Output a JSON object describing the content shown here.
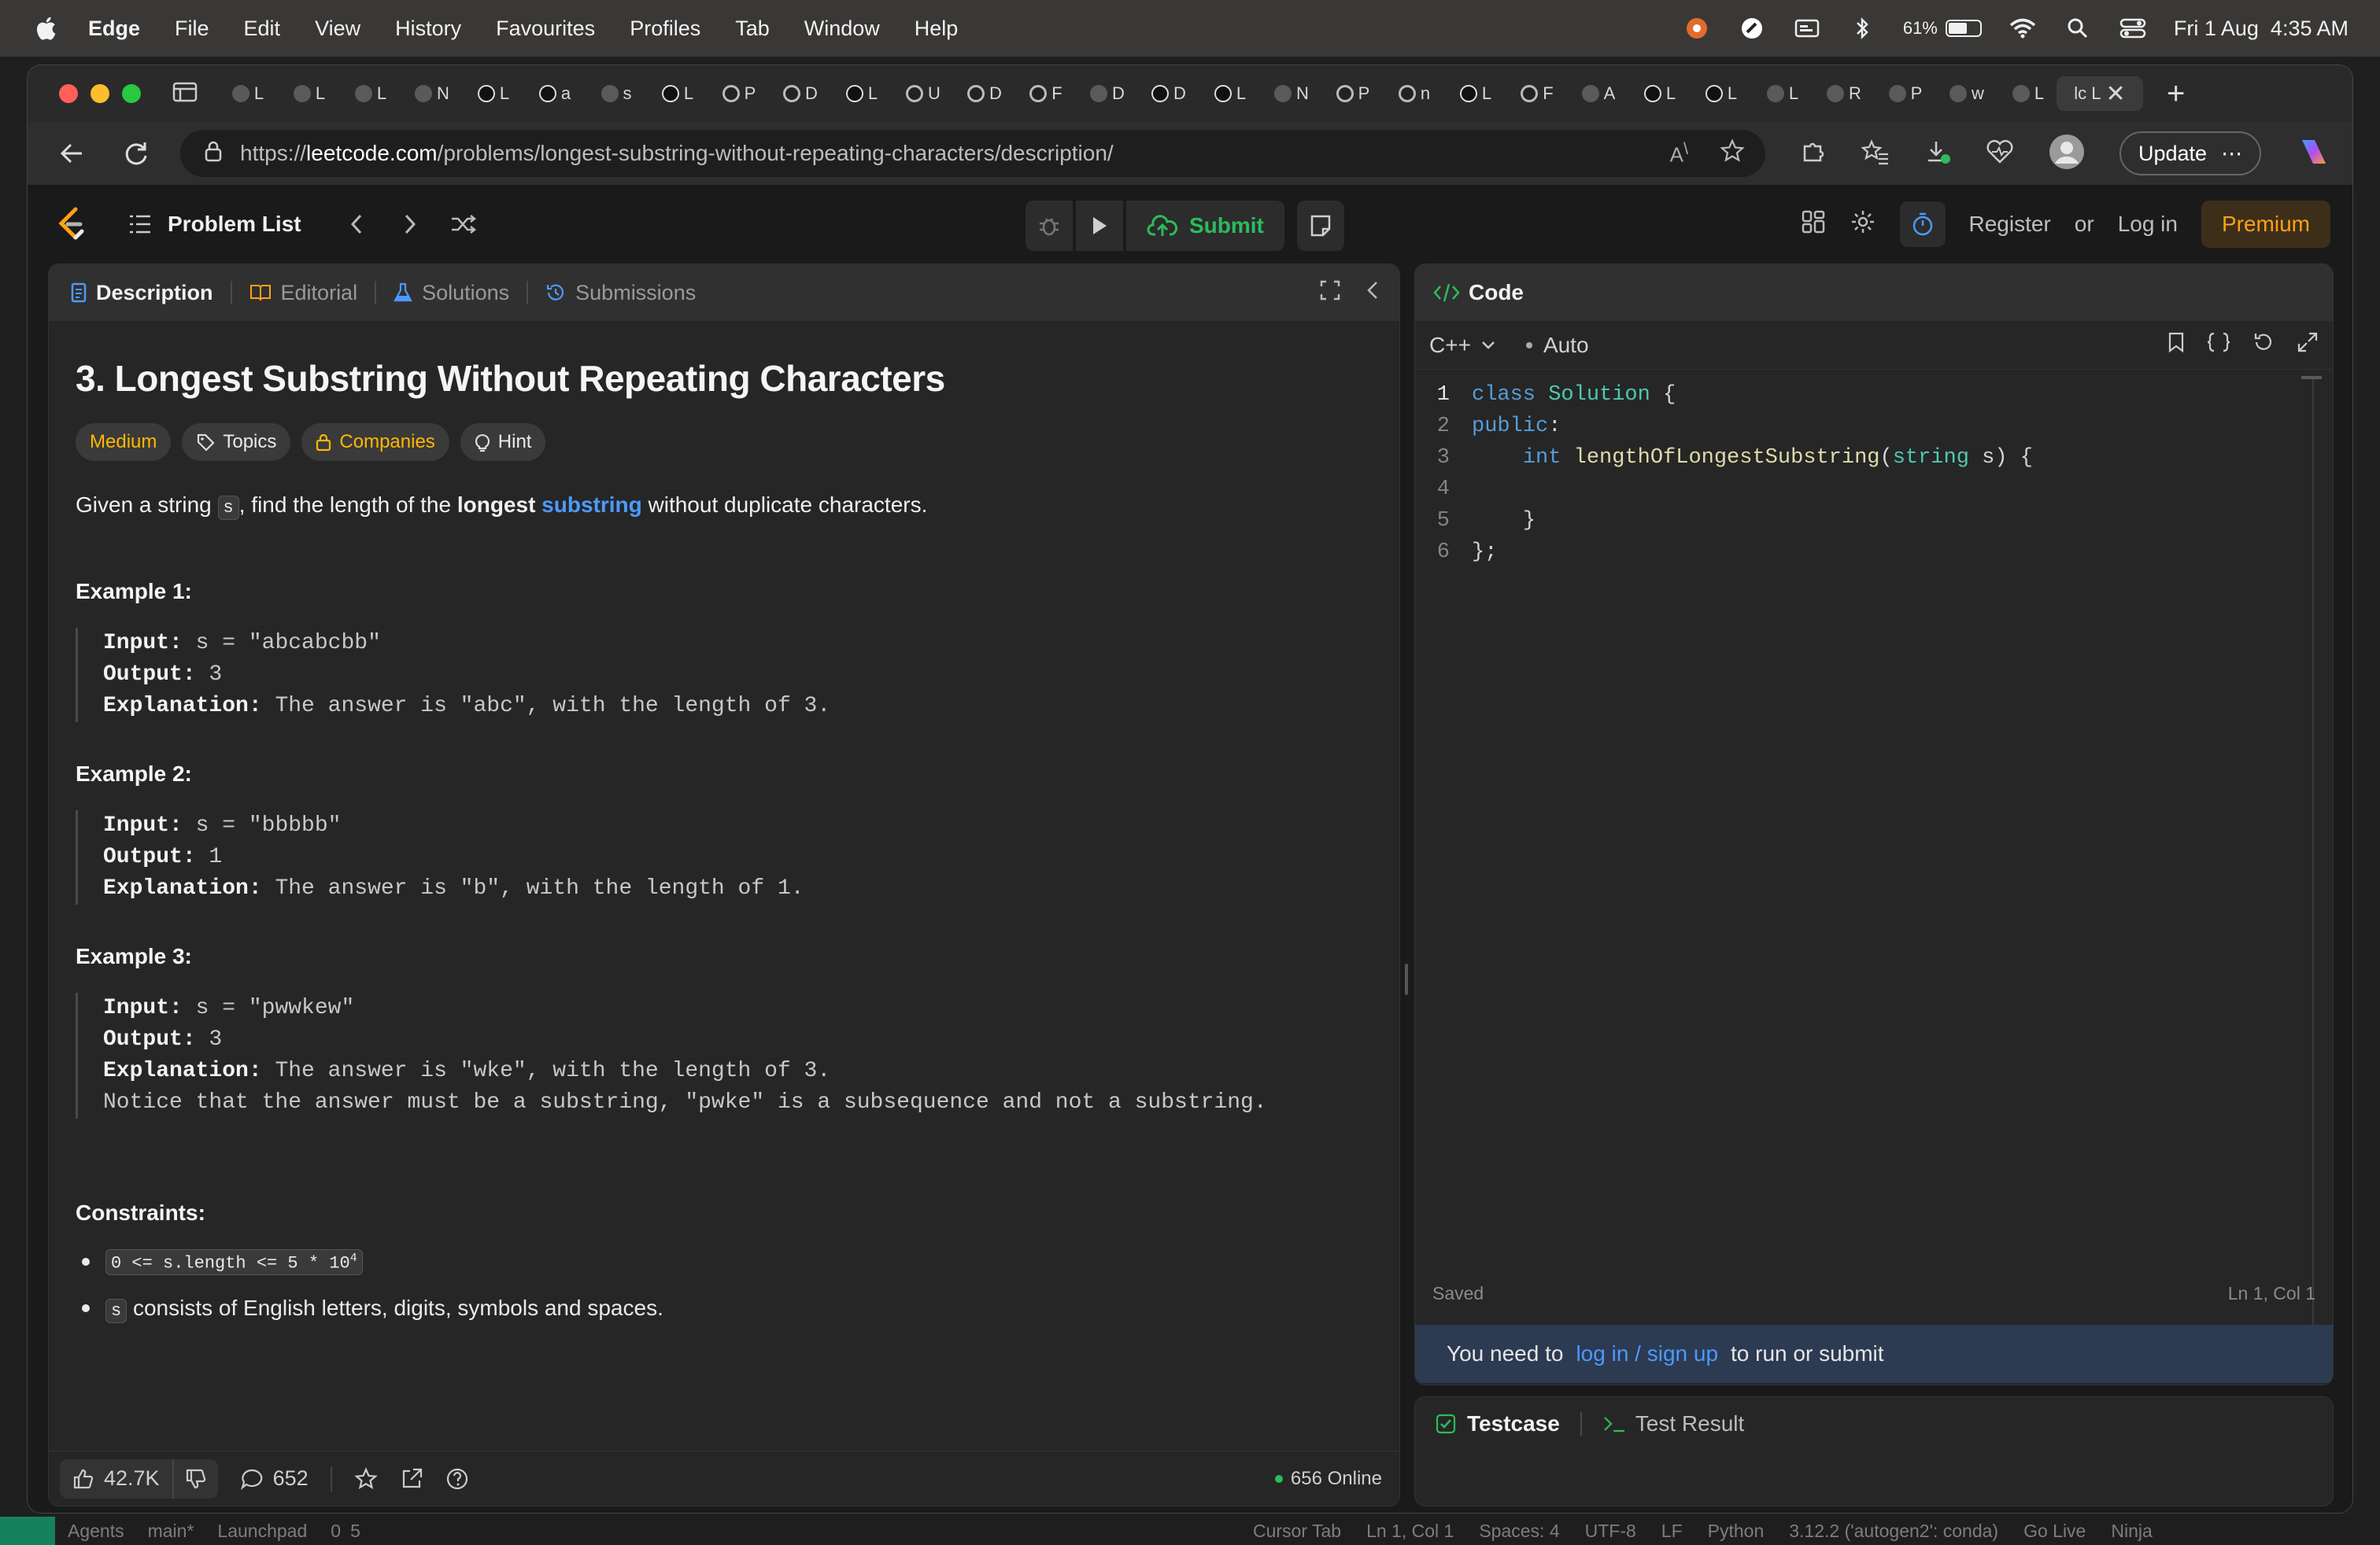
{
  "menubar": {
    "app": "Edge",
    "items": [
      "File",
      "Edit",
      "View",
      "History",
      "Favourites",
      "Profiles",
      "Tab",
      "Window",
      "Help"
    ],
    "battery": "61%",
    "battery_level": 0.61,
    "datetime": "Fri 1 Aug  4:35 AM"
  },
  "browser": {
    "tab_letters": [
      "L",
      "L",
      "L",
      "N",
      "L",
      "a",
      "s",
      "L",
      "P",
      "D",
      "L",
      "U",
      "D",
      "F",
      "D",
      "D",
      "L",
      "N",
      "P",
      "n",
      "L",
      "F",
      "A",
      "L",
      "L",
      "L",
      "R",
      "P",
      "w",
      "L"
    ],
    "active_tab": "lc L",
    "url_host": "leetcode.com",
    "url_prefix": "https://",
    "url_path": "/problems/longest-substring-without-repeating-characters/description/",
    "update_label": "Update"
  },
  "lc": {
    "problem_list": "Problem List",
    "submit": "Submit",
    "register": "Register",
    "or": "or",
    "login": "Log in",
    "premium": "Premium"
  },
  "desc": {
    "tabs": [
      "Description",
      "Editorial",
      "Solutions",
      "Submissions"
    ],
    "title": "3. Longest Substring Without Repeating Characters",
    "chips": {
      "difficulty": "Medium",
      "topics": "Topics",
      "companies": "Companies",
      "hint": "Hint"
    },
    "statement": {
      "pre": "Given a string ",
      "code": "s",
      "mid": ", find the length of the ",
      "bold": "longest",
      "link": "substring",
      "post": " without duplicate characters."
    },
    "examples": [
      {
        "title": "Example 1:",
        "input_label": "Input:",
        "input": " s = \"abcabcbb\"",
        "output_label": "Output:",
        "output": " 3",
        "expl_label": "Explanation:",
        "expl": " The answer is \"abc\", with the length of 3.",
        "note": ""
      },
      {
        "title": "Example 2:",
        "input_label": "Input:",
        "input": " s = \"bbbbb\"",
        "output_label": "Output:",
        "output": " 1",
        "expl_label": "Explanation:",
        "expl": " The answer is \"b\", with the length of 1.",
        "note": ""
      },
      {
        "title": "Example 3:",
        "input_label": "Input:",
        "input": " s = \"pwwkew\"",
        "output_label": "Output:",
        "output": " 3",
        "expl_label": "Explanation:",
        "expl": " The answer is \"wke\", with the length of 3.",
        "note": "Notice that the answer must be a substring, \"pwke\" is a subsequence and not a substring."
      }
    ],
    "constraints_title": "Constraints:",
    "constraint1_code": "0 <= s.length <= 5 * 10",
    "constraint1_sup": "4",
    "constraint2_code": "s",
    "constraint2_text": " consists of English letters, digits, symbols and spaces.",
    "footer": {
      "likes": "42.7K",
      "comments": "652",
      "online": "656 Online"
    }
  },
  "code": {
    "title": "Code",
    "language": "C++",
    "mode": "Auto",
    "line_numbers": [
      "1",
      "2",
      "3",
      "4",
      "5",
      "6"
    ],
    "saved": "Saved",
    "cursor": "Ln 1, Col 1",
    "login_pre": "You need to",
    "login_link": "log in / sign up",
    "login_post": "to run or submit"
  },
  "test": {
    "testcase": "Testcase",
    "result": "Test Result"
  },
  "vscode": {
    "left": [
      "Agents",
      "main*",
      "Launchpad",
      "0",
      "5"
    ],
    "right": [
      "Cursor Tab",
      "Ln 1, Col 1",
      "Spaces: 4",
      "UTF-8",
      "LF",
      "Python",
      "3.12.2 ('autogen2': conda)",
      "Go Live",
      "Ninja"
    ]
  }
}
